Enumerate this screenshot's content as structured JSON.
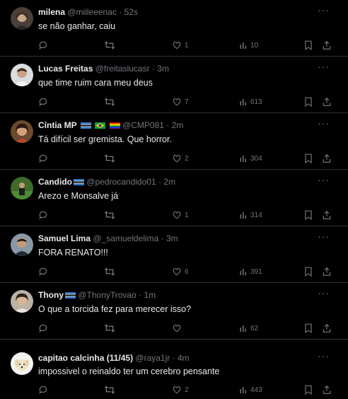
{
  "tweets": [
    {
      "name": "milena",
      "handle": "@miileeenac",
      "time": "52s",
      "text": "se não ganhar, caiu",
      "likes": "1",
      "views": "10",
      "flags": []
    },
    {
      "name": "Lucas Freitas",
      "handle": "@freitaslucasr",
      "time": "3m",
      "text": "que time ruim cara meu deus",
      "likes": "7",
      "views": "613",
      "flags": []
    },
    {
      "name": "Cíntia MP",
      "handle": "@CMP081",
      "time": "2m",
      "text": "Tá difícil ser gremista. Que horror.",
      "likes": "2",
      "views": "304",
      "flags": [
        "gremio",
        "brazil",
        "rainbow"
      ]
    },
    {
      "name": "Candido",
      "handle": "@pedrocandido01",
      "time": "2m",
      "text": "Arezo e Monsalve já",
      "likes": "1",
      "views": "314",
      "flags": [
        "gremio"
      ]
    },
    {
      "name": "Samuel Lima",
      "handle": "@_samueldelima",
      "time": "3m",
      "text": "FORA RENATO!!!",
      "likes": "6",
      "views": "391",
      "flags": []
    },
    {
      "name": "Thony",
      "handle": "@ThonyTrovao",
      "time": "1m",
      "text": "O que a torcida fez para merecer isso?",
      "likes": "",
      "views": "62",
      "flags": [
        "gremio"
      ]
    },
    {
      "name": "capitao calcinha (11/45)",
      "handle": "@raya1jr",
      "time": "4m",
      "text": "impossivel o reinaldo ter um cerebro pensante",
      "likes": "2",
      "views": "443",
      "flags": []
    }
  ],
  "separator": "·",
  "colors": {
    "background": "#000000",
    "text": "#e7e9ea",
    "muted": "#71767b",
    "divider": "#2f3336"
  }
}
